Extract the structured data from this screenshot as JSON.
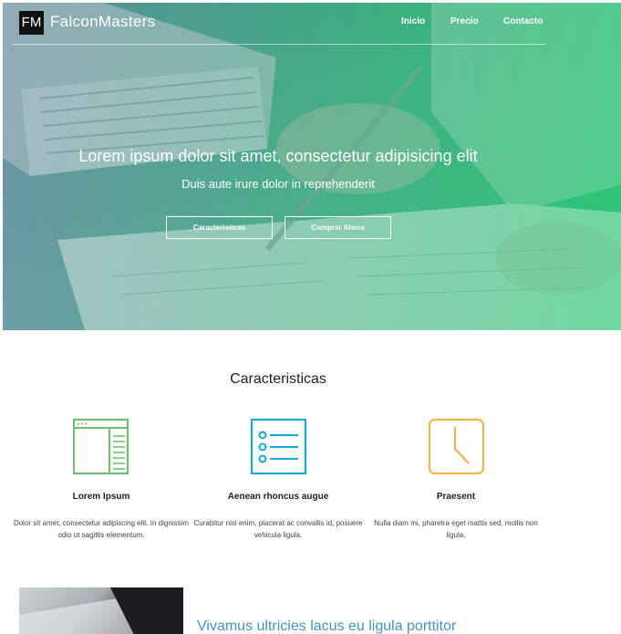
{
  "navbar": {
    "logo_text": "FM",
    "brand": "FalconMasters",
    "links": [
      "Inicio",
      "Precio",
      "Contacto"
    ]
  },
  "hero": {
    "title": "Lorem ipsum dolor sit amet, consectetur adipisicing elit",
    "subtitle": "Duis aute irure dolor in reprehenderit",
    "buttons": [
      "Caracteristicas",
      "Comprar Ahora"
    ]
  },
  "features": {
    "title": "Caracteristicas",
    "items": [
      {
        "icon": "browser-window-icon",
        "heading": "Lorem Ipsum",
        "text": "Dolor sit amet, consectetur adipiscing elit. In dignissim odio ut sagittis elementum.",
        "color": "#6fbf73"
      },
      {
        "icon": "checklist-icon",
        "heading": "Aenean rhoncus augue",
        "text": "Curabitur nisl enim, placerat ac convallis id, posuere vehicula ligula.",
        "color": "#1aa6d6"
      },
      {
        "icon": "clock-icon",
        "heading": "Praesent",
        "text": "Nulla diam mi, pharetra eget mattis sed, mollis non ligula.",
        "color": "#f0b64a"
      }
    ]
  },
  "bottom": {
    "heading": "Vivamus ultricies lacus eu ligula porttitor",
    "heading_color": "#4a90c4"
  },
  "colors": {
    "hero_gradient_start": "#407d8c",
    "hero_gradient_end": "#28be6e"
  }
}
